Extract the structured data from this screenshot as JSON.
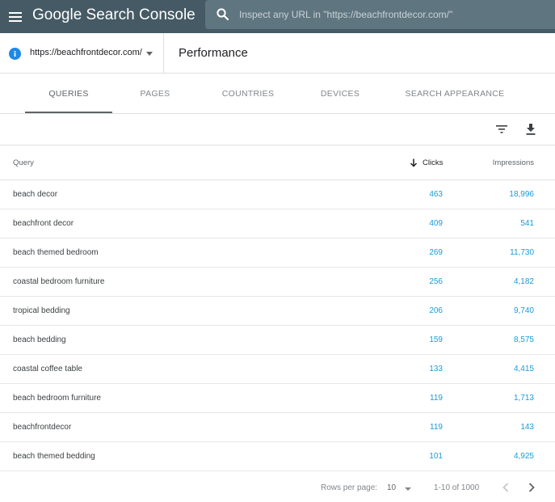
{
  "header": {
    "app_title": "Google Search Console",
    "menu_icon": "hamburger-menu-icon",
    "search_icon": "search-icon",
    "search_placeholder": "Inspect any URL in \"https://beachfrontdecor.com/\""
  },
  "property": {
    "url": "https://beachfrontdecor.com/",
    "icon": "site-info-icon"
  },
  "page": {
    "title": "Performance"
  },
  "tabs": [
    {
      "label": "QUERIES",
      "active": true
    },
    {
      "label": "PAGES",
      "active": false
    },
    {
      "label": "COUNTRIES",
      "active": false
    },
    {
      "label": "DEVICES",
      "active": false
    },
    {
      "label": "SEARCH APPEARANCE",
      "active": false
    }
  ],
  "toolbar": {
    "filter_icon": "filter-icon",
    "download_icon": "download-icon"
  },
  "table": {
    "columns": {
      "query": "Query",
      "clicks": "Clicks",
      "impressions": "Impressions"
    },
    "sort_icon": "arrow-down-icon",
    "rows": [
      {
        "query": "beach decor",
        "clicks": "463",
        "impressions": "18,996"
      },
      {
        "query": "beachfront decor",
        "clicks": "409",
        "impressions": "541"
      },
      {
        "query": "beach themed bedroom",
        "clicks": "269",
        "impressions": "11,730"
      },
      {
        "query": "coastal bedroom furniture",
        "clicks": "256",
        "impressions": "4,182"
      },
      {
        "query": "tropical bedding",
        "clicks": "206",
        "impressions": "9,740"
      },
      {
        "query": "beach bedding",
        "clicks": "159",
        "impressions": "8,575"
      },
      {
        "query": "coastal coffee table",
        "clicks": "133",
        "impressions": "4,415"
      },
      {
        "query": "beach bedroom furniture",
        "clicks": "119",
        "impressions": "1,713"
      },
      {
        "query": "beachfrontdecor",
        "clicks": "119",
        "impressions": "143"
      },
      {
        "query": "beach themed bedding",
        "clicks": "101",
        "impressions": "4,925"
      }
    ]
  },
  "pagination": {
    "rows_per_page_label": "Rows per page:",
    "rows_per_page_value": "10",
    "range_text": "1-10 of 1000"
  },
  "colors": {
    "app_bar": "#455a64",
    "link_blue": "#1a9ad6",
    "info_icon_blue": "#1e88e5"
  }
}
